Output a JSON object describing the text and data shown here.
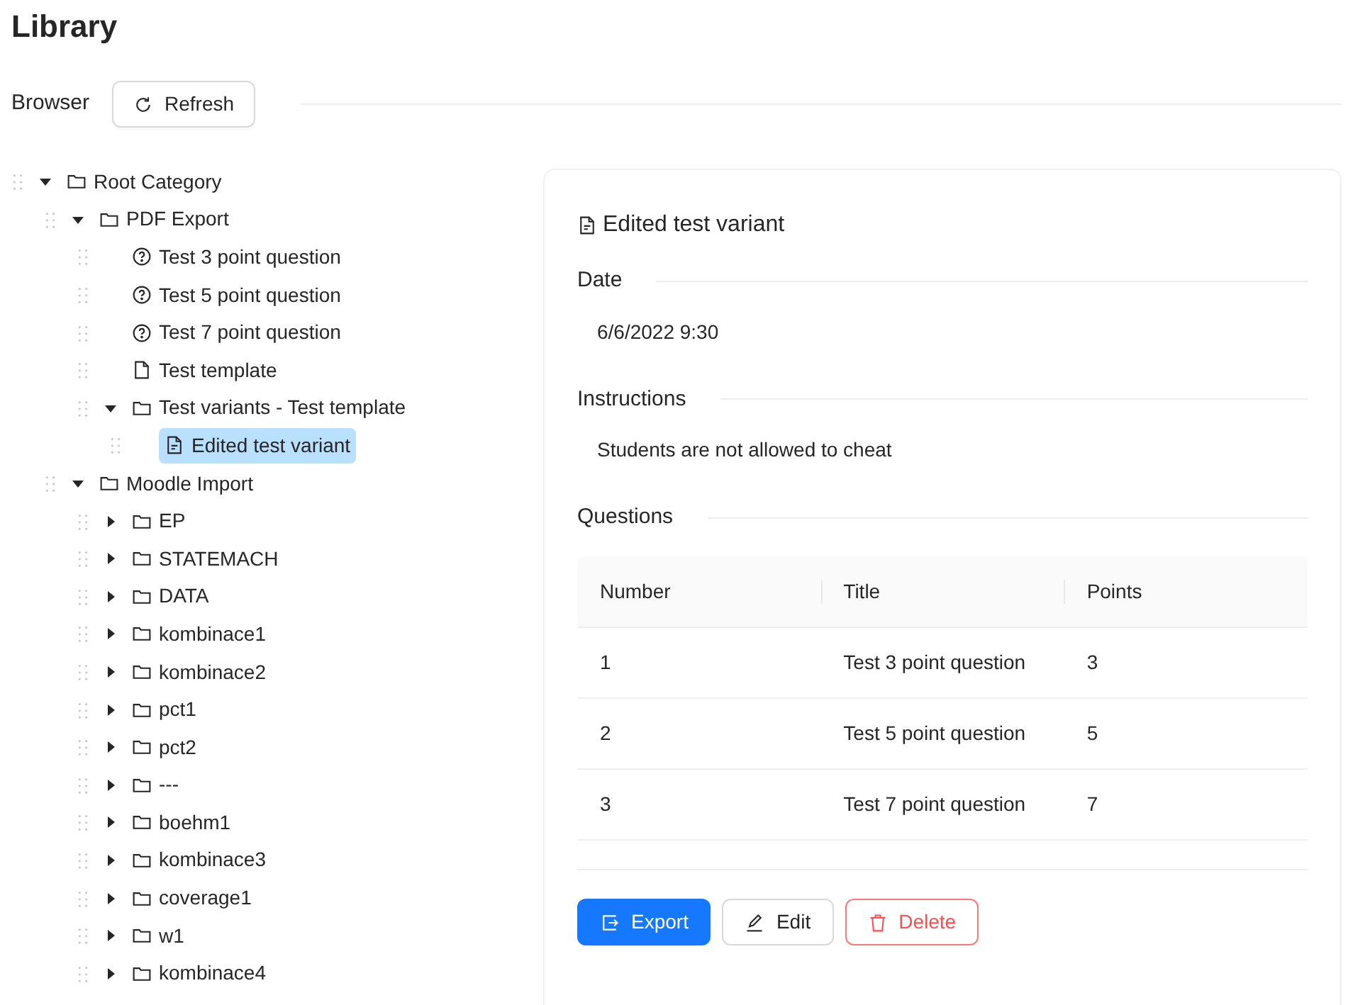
{
  "page": {
    "title": "Library"
  },
  "toolbar": {
    "label": "Browser",
    "refresh_button": "Refresh"
  },
  "tree": [
    {
      "kind": "folder",
      "label": "Root Category",
      "expanded": true,
      "selected": false,
      "children": [
        {
          "kind": "folder",
          "label": "PDF Export",
          "expanded": true,
          "selected": false,
          "children": [
            {
              "kind": "question",
              "label": "Test 3 point question",
              "selected": false
            },
            {
              "kind": "question",
              "label": "Test 5 point question",
              "selected": false
            },
            {
              "kind": "question",
              "label": "Test 7 point question",
              "selected": false
            },
            {
              "kind": "template",
              "label": "Test template",
              "selected": false
            },
            {
              "kind": "folder",
              "label": "Test variants - Test template",
              "expanded": true,
              "selected": false,
              "children": [
                {
                  "kind": "variant",
                  "label": "Edited test variant",
                  "selected": true
                }
              ]
            }
          ]
        },
        {
          "kind": "folder",
          "label": "Moodle Import",
          "expanded": true,
          "selected": false,
          "children": [
            {
              "kind": "folder",
              "label": "EP",
              "expanded": false,
              "selected": false
            },
            {
              "kind": "folder",
              "label": "STATEMACH",
              "expanded": false,
              "selected": false
            },
            {
              "kind": "folder",
              "label": "DATA",
              "expanded": false,
              "selected": false
            },
            {
              "kind": "folder",
              "label": "kombinace1",
              "expanded": false,
              "selected": false
            },
            {
              "kind": "folder",
              "label": "kombinace2",
              "expanded": false,
              "selected": false
            },
            {
              "kind": "folder",
              "label": "pct1",
              "expanded": false,
              "selected": false
            },
            {
              "kind": "folder",
              "label": "pct2",
              "expanded": false,
              "selected": false
            },
            {
              "kind": "folder",
              "label": "---",
              "expanded": false,
              "selected": false
            },
            {
              "kind": "folder",
              "label": "boehm1",
              "expanded": false,
              "selected": false
            },
            {
              "kind": "folder",
              "label": "kombinace3",
              "expanded": false,
              "selected": false
            },
            {
              "kind": "folder",
              "label": "coverage1",
              "expanded": false,
              "selected": false
            },
            {
              "kind": "folder",
              "label": "w1",
              "expanded": false,
              "selected": false
            },
            {
              "kind": "folder",
              "label": "kombinace4",
              "expanded": false,
              "selected": false
            }
          ]
        }
      ]
    }
  ],
  "detail": {
    "title": "Edited test variant",
    "sections": [
      {
        "heading": "Date",
        "value": "6/6/2022 9:30"
      },
      {
        "heading": "Instructions",
        "value": "Students are not allowed to cheat"
      }
    ],
    "questions": {
      "heading": "Questions",
      "columns": [
        "Number",
        "Title",
        "Points"
      ],
      "rows": [
        [
          "1",
          "Test 3 point question",
          "3"
        ],
        [
          "2",
          "Test 5 point question",
          "5"
        ],
        [
          "3",
          "Test 7 point question",
          "7"
        ]
      ]
    },
    "actions": [
      {
        "kind": "primary",
        "label": "Export"
      },
      {
        "kind": "default",
        "label": "Edit"
      },
      {
        "kind": "danger",
        "label": "Delete"
      }
    ]
  }
}
